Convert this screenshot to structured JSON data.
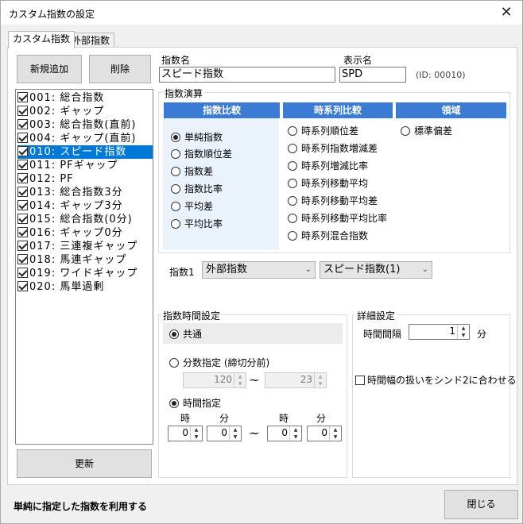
{
  "window": {
    "title": "カスタム指数の設定",
    "close_icon": "close-icon"
  },
  "tabs": [
    {
      "label": "カスタム指数"
    },
    {
      "label": "外部指数"
    }
  ],
  "left": {
    "new_button": "新規追加",
    "delete_button": "削除",
    "update_button": "更新",
    "items": [
      {
        "label": "001: 総合指数",
        "checked": true
      },
      {
        "label": "002: ギャップ",
        "checked": true
      },
      {
        "label": "003: 総合指数(直前)",
        "checked": true
      },
      {
        "label": "004: ギャップ(直前)",
        "checked": true
      },
      {
        "label": "010: スピード指数",
        "checked": true,
        "selected": true
      },
      {
        "label": "011: PFギャップ",
        "checked": true
      },
      {
        "label": "012: PF",
        "checked": true
      },
      {
        "label": "013: 総合指数3分",
        "checked": true
      },
      {
        "label": "014: ギャップ3分",
        "checked": true
      },
      {
        "label": "015: 総合指数(0分)",
        "checked": true
      },
      {
        "label": "016: ギャップ0分",
        "checked": true
      },
      {
        "label": "017: 三連複ギャップ",
        "checked": true
      },
      {
        "label": "018: 馬連ギャップ",
        "checked": true
      },
      {
        "label": "019: ワイドギャップ",
        "checked": true
      },
      {
        "label": "020: 馬単過剰",
        "checked": true
      }
    ]
  },
  "form": {
    "name_label": "指数名",
    "name_value": "スピード指数",
    "display_label": "表示名",
    "display_value": "SPD",
    "id_text": "(ID: 00010)"
  },
  "calc": {
    "group_label": "指数演算",
    "col1": {
      "header": "指数比較",
      "options": [
        "単純指数",
        "指数順位差",
        "指数差",
        "指数比率",
        "平均差",
        "平均比率"
      ]
    },
    "col2": {
      "header": "時系列比較",
      "options": [
        "時系列順位差",
        "時系列指数増減差",
        "時系列増減比率",
        "時系列移動平均",
        "時系列移動平均差",
        "時系列移動平均比率",
        "時系列混合指数"
      ]
    },
    "col3": {
      "header": "領域",
      "options": [
        "標準偏差"
      ]
    },
    "selected": "単純指数"
  },
  "index1": {
    "label": "指数1",
    "source": "外部指数",
    "value": "スピード指数(1)"
  },
  "timing": {
    "group_label": "指数時間設定",
    "common": "共通",
    "minutes_label": "分数指定 (締切分前)",
    "from_min": "120",
    "tilde": "~",
    "to_min": "23",
    "time_label": "時間指定",
    "h_label": "時",
    "m_label": "分",
    "h1": "0",
    "m1": "0",
    "h2": "0",
    "m2": "0"
  },
  "detail": {
    "group_label": "詳細設定",
    "interval_label": "時間間隔",
    "interval_value": "1",
    "interval_unit": "分",
    "sync_label": "時間幅の扱いをシンド2に合わせる"
  },
  "footer": {
    "status": "単純に指定した指数を利用する",
    "close_button": "閉じる"
  }
}
